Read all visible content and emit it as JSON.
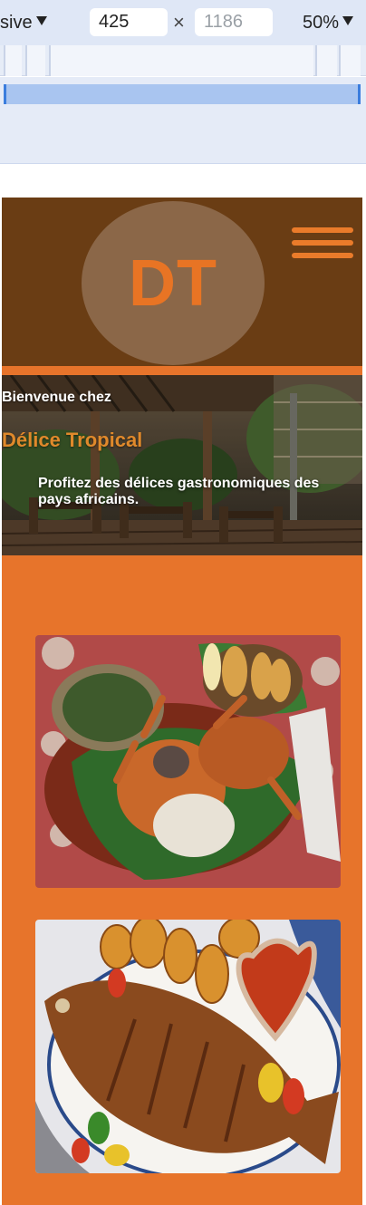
{
  "toolbar": {
    "mode_label": "sive",
    "width_value": "425",
    "height_placeholder": "1186",
    "times_symbol": "×",
    "zoom_label": "50%"
  },
  "site": {
    "logo_text": "DT",
    "hero": {
      "welcome": "Bienvenue chez",
      "title": "Délice Tropical",
      "subtitle": "Profitez des délices gastronomiques des pays africains."
    },
    "icons": [
      "hamburger-menu-icon"
    ]
  },
  "colors": {
    "header_bg": "#6a3d14",
    "logo_circle": "#8b6748",
    "accent_orange": "#e7742b",
    "title_orange": "#e0892b"
  }
}
